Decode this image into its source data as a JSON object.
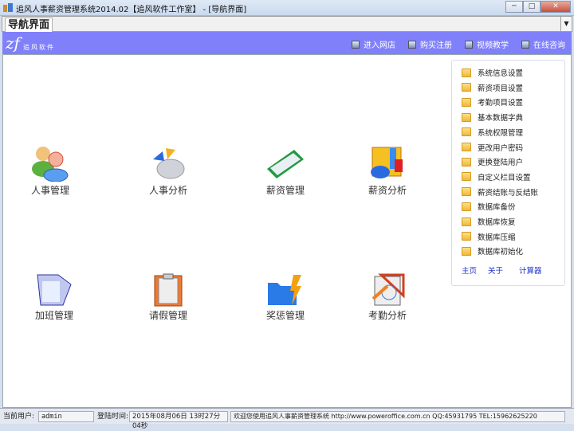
{
  "window": {
    "title": "追风人事薪资管理系统2014.02【追风软件工作室】 - [导航界面]",
    "minimize": "─",
    "maximize": "□",
    "close": "✕"
  },
  "tab": {
    "label": "导航界面",
    "dropdown": "▼"
  },
  "banner": {
    "logo": "zf",
    "logo_text": "追风软件",
    "links": [
      {
        "label": "进入网店"
      },
      {
        "label": "购买注册"
      },
      {
        "label": "视频教学"
      },
      {
        "label": "在线咨询"
      }
    ]
  },
  "modules": [
    {
      "label": "人事管理",
      "icon": "users-icon"
    },
    {
      "label": "人事分析",
      "icon": "pie-chart-icon"
    },
    {
      "label": "薪资管理",
      "icon": "book-icon"
    },
    {
      "label": "薪资分析",
      "icon": "bar-chart-icon"
    },
    {
      "label": "加班管理",
      "icon": "notepad-icon"
    },
    {
      "label": "请假管理",
      "icon": "clipboard-icon"
    },
    {
      "label": "奖惩管理",
      "icon": "folder-lightning-icon"
    },
    {
      "label": "考勤分析",
      "icon": "ruler-pencil-icon"
    }
  ],
  "panel": {
    "items": [
      "系统信息设置",
      "薪资项目设置",
      "考勤项目设置",
      "基本数据字典",
      "系统权限管理",
      "更改用户密码",
      "更换登陆用户",
      "自定义栏目设置",
      "薪资结账与反结账",
      "数据库备份",
      "数据库恢复",
      "数据库压缩",
      "数据库初始化"
    ],
    "links": [
      "主页",
      "关于",
      "计算器"
    ]
  },
  "status": {
    "user_label": "当前用户:",
    "user": "admin",
    "login_label": "登陆时间:",
    "login_time": "2015年08月06日 13时27分04秒",
    "welcome": "欢迎您使用追风人事薪资管理系统 http://www.poweroffice.com.cn QQ:45931795 TEL:15962625220"
  }
}
